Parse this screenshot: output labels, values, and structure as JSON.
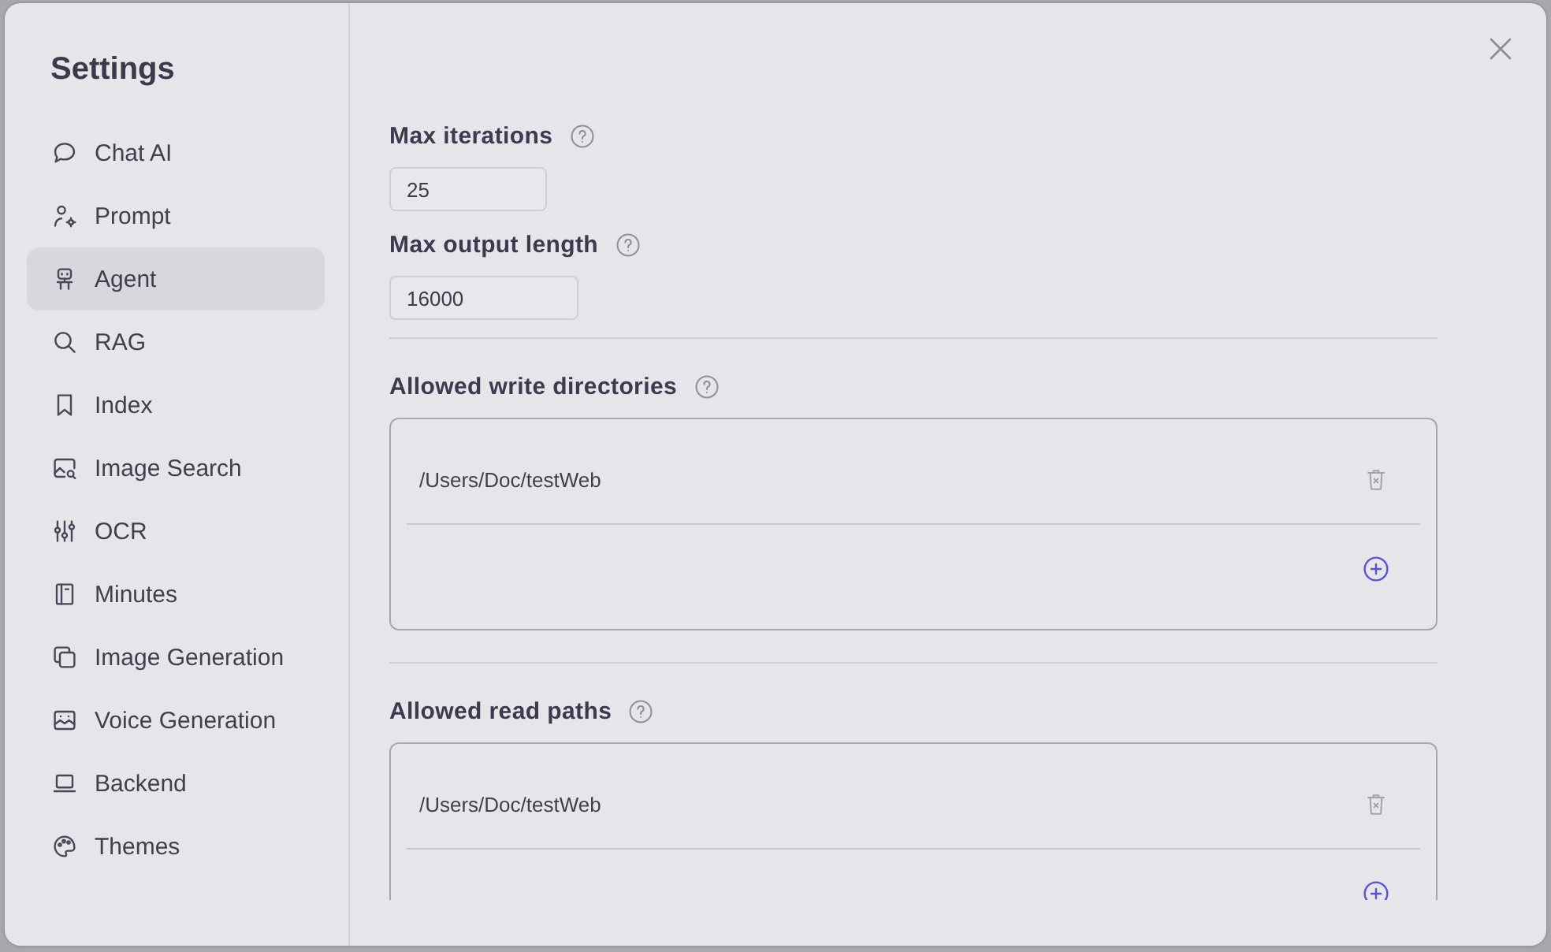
{
  "dialog": {
    "sidebar": {
      "title": "Settings",
      "items": [
        {
          "label": "Chat AI",
          "selected": false
        },
        {
          "label": "Prompt",
          "selected": false
        },
        {
          "label": "Agent",
          "selected": true
        },
        {
          "label": "RAG",
          "selected": false
        },
        {
          "label": "Index",
          "selected": false
        },
        {
          "label": "Image Search",
          "selected": false
        },
        {
          "label": "OCR",
          "selected": false
        },
        {
          "label": "Minutes",
          "selected": false
        },
        {
          "label": "Image Generation",
          "selected": false
        },
        {
          "label": "Voice Generation",
          "selected": false
        },
        {
          "label": "Backend",
          "selected": false
        },
        {
          "label": "Themes",
          "selected": false
        }
      ]
    },
    "content": {
      "sections": [
        {
          "kind": "number",
          "label": "Max iterations",
          "value": "25"
        },
        {
          "kind": "number",
          "label": "Max output length",
          "value": "16000"
        },
        {
          "kind": "path_list",
          "label": "Allowed write directories",
          "paths": [
            "/Users/Doc/testWeb"
          ]
        },
        {
          "kind": "path_list",
          "label": "Allowed read paths",
          "paths": [
            "/Users/Doc/testWeb"
          ]
        }
      ]
    }
  }
}
